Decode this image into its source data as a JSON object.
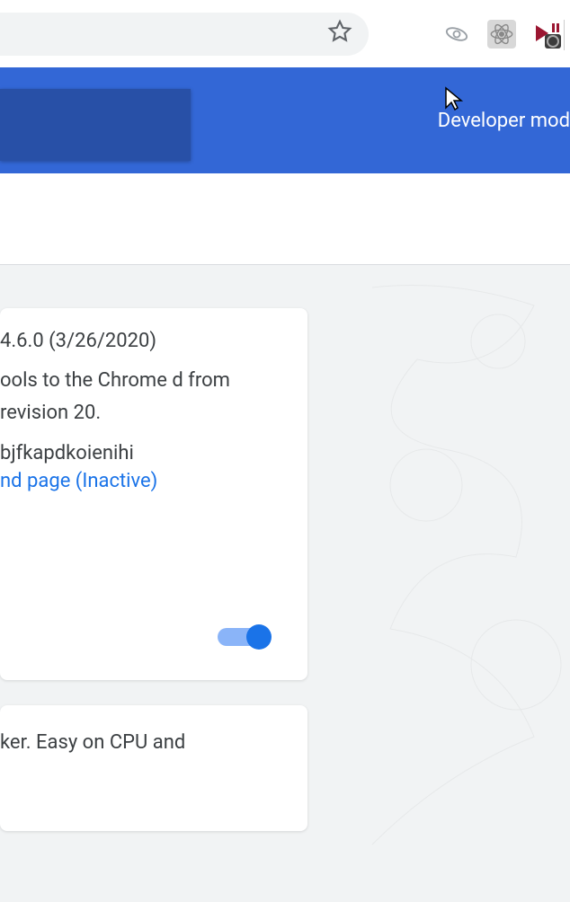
{
  "browser": {
    "star_icon": "star-icon",
    "extensions": [
      {
        "name": "orbit-extension-icon"
      },
      {
        "name": "react-extension-icon"
      },
      {
        "name": "devtools-extension-icon"
      }
    ]
  },
  "header": {
    "developer_mode_label": "Developer mod"
  },
  "cards": [
    {
      "title": "4.6.0 (3/26/2020)",
      "description": "ools to the Chrome d from revision 20.",
      "id_fragment": "bjfkapdkoienihi",
      "link_text": "nd page (Inactive)",
      "toggle_on": true
    },
    {
      "description": "ker. Easy on CPU and"
    }
  ]
}
